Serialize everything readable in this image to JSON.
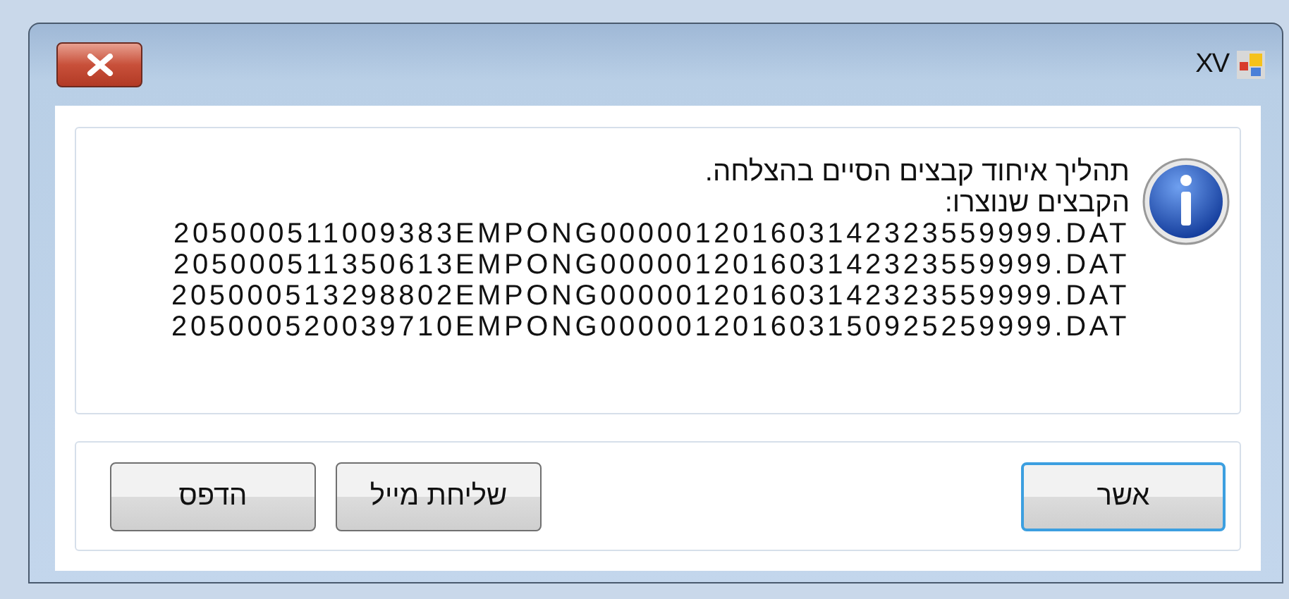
{
  "window": {
    "title": "XV"
  },
  "message": {
    "lines": [
      "תהליך איחוד קבצים הסיים בהצלחה.",
      "הקבצים שנוצרו:",
      "205000511009383EMPONG000001201603142323559999.DAT",
      "205000511350613EMPONG000001201603142323559999.DAT",
      "205000513298802EMPONG000001201603142323559999.DAT",
      "205000520039710EMPONG000001201603150925259999.DAT"
    ]
  },
  "buttons": [
    {
      "label": "אשר",
      "default": true
    },
    {
      "label": "שליחת מייל",
      "default": false
    },
    {
      "label": "הדפס",
      "default": false
    }
  ]
}
